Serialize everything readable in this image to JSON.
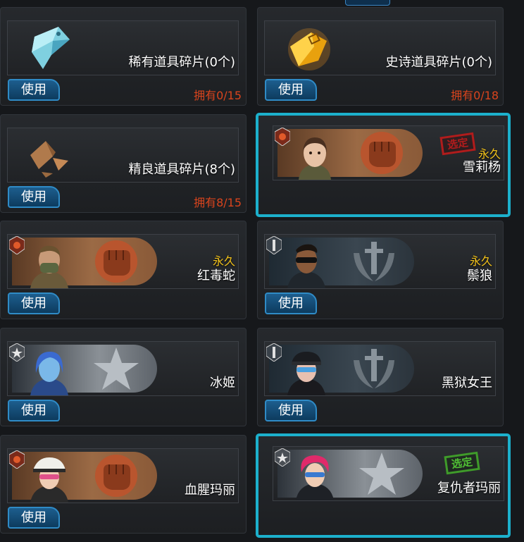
{
  "colors": {
    "accent_selected": "#1cb0cc",
    "use_button": "#1d5e8e",
    "own_text": "#d9441d",
    "permanent_text": "#f2c21b"
  },
  "cards": [
    {
      "name": "稀有道具碎片(0个)",
      "use": "使用",
      "own": "拥有0/15",
      "icon": "rare-shard-icon"
    },
    {
      "name": "史诗道具碎片(0个)",
      "use": "使用",
      "own": "拥有0/18",
      "icon": "epic-shard-icon"
    },
    {
      "name": "精良道具碎片(8个)",
      "use": "使用",
      "own": "拥有8/15",
      "icon": "fine-shard-icon"
    },
    {
      "name": "雪莉杨",
      "perm": "永久",
      "stamp": "选定",
      "icon": "fist-emblem-icon"
    },
    {
      "name": "红毒蛇",
      "perm": "永久",
      "use": "使用",
      "icon": "fist-emblem-icon"
    },
    {
      "name": "鬃狼",
      "perm": "永久",
      "use": "使用",
      "icon": "dagger-wreath-emblem-icon"
    },
    {
      "name": "冰姬",
      "use": "使用",
      "icon": "star-emblem-icon"
    },
    {
      "name": "黑狱女王",
      "use": "使用",
      "icon": "dagger-wreath-emblem-icon"
    },
    {
      "name": "血腥玛丽",
      "use": "使用",
      "icon": "fist-emblem-icon"
    },
    {
      "name": "复仇者玛丽",
      "stamp": "选定",
      "icon": "star-emblem-icon"
    }
  ]
}
